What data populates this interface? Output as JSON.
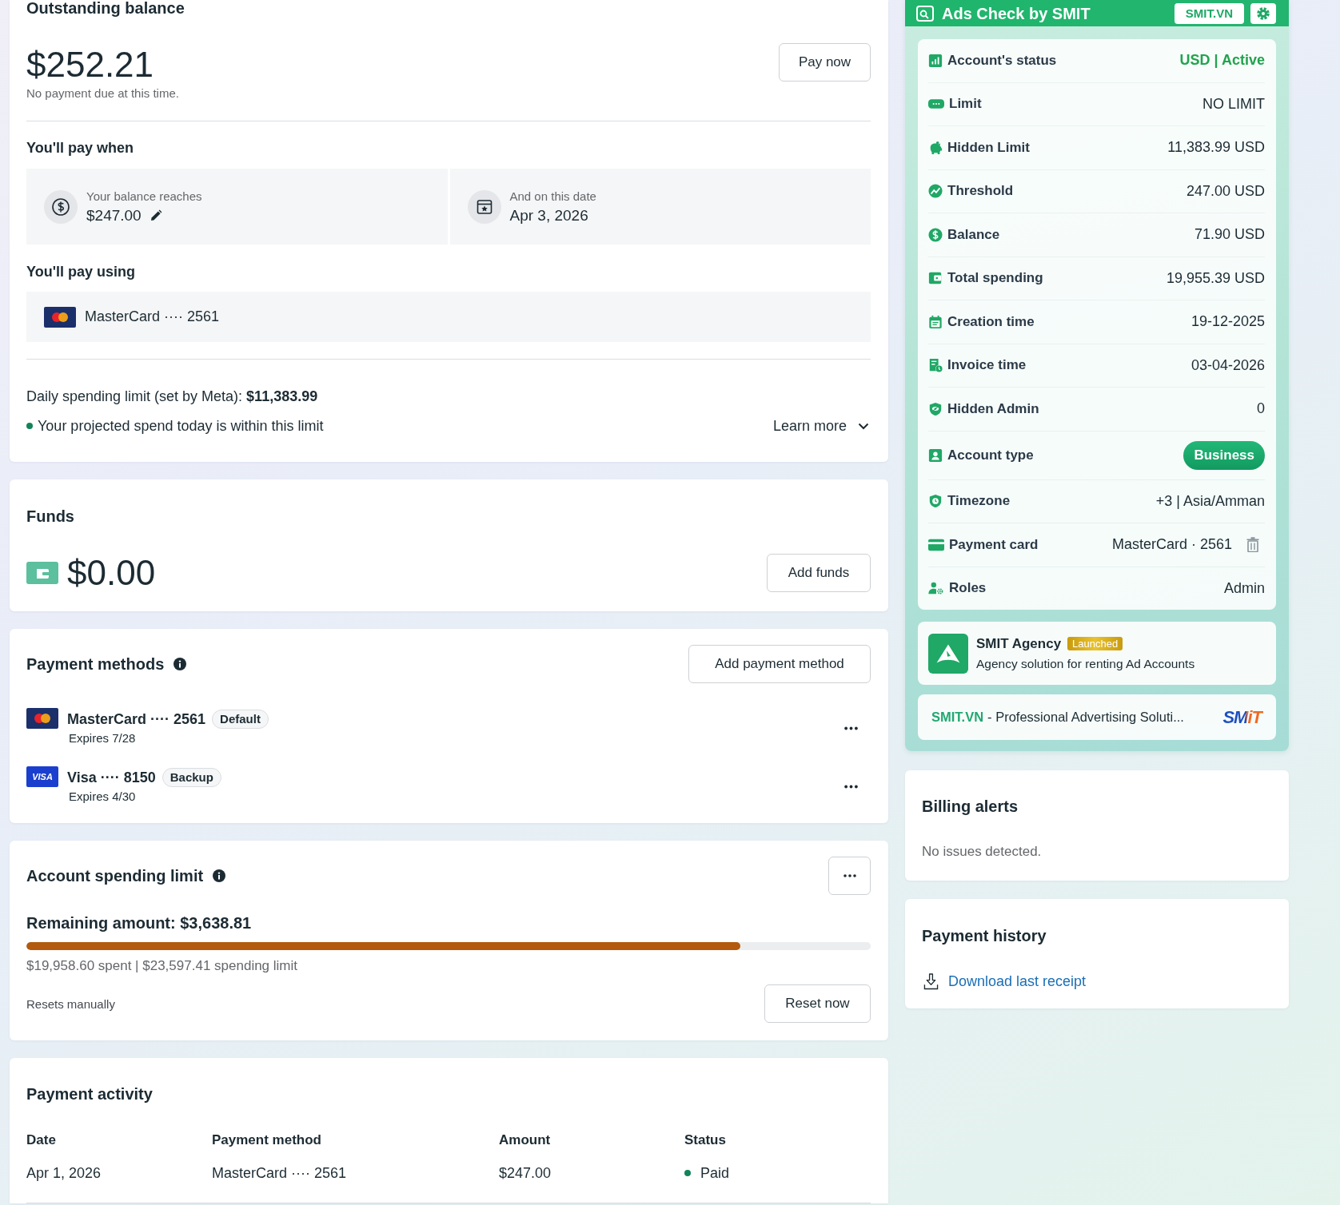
{
  "outstanding_balance": {
    "title": "Outstanding balance",
    "amount": "$252.21",
    "note": "No payment due at this time.",
    "pay_button": "Pay now"
  },
  "pay_when": {
    "title": "You'll pay when",
    "conditions": [
      {
        "kind": "balance",
        "label": "Your balance reaches",
        "value": "$247.00"
      },
      {
        "kind": "date",
        "label": "And on this date",
        "value": "Apr 3, 2026"
      }
    ]
  },
  "pay_using": {
    "title": "You'll pay using",
    "card": {
      "kind": "mastercard",
      "name": "MasterCard ···· 2561"
    }
  },
  "daily_limit": {
    "text": "Daily spending limit (set by Meta): **$11,383.99**",
    "projection": "Your projected spend today is within this limit",
    "learn_more": "Learn more"
  },
  "funds": {
    "title": "Funds",
    "amount": "$0.00",
    "button": "Add funds"
  },
  "payment_methods": {
    "title": "Payment methods",
    "add_button": "Add payment method",
    "methods": [
      {
        "kind": "mastercard",
        "name": "MasterCard ···· 2561",
        "badge": "Default",
        "expires": "Expires 7/28"
      },
      {
        "kind": "visa",
        "logo": "VISA",
        "name": "Visa ···· 8150",
        "badge": "Backup",
        "expires": "Expires 4/30"
      }
    ]
  },
  "spending_limit": {
    "title": "Account spending limit",
    "remaining": "Remaining amount: $3,638.81",
    "level": 0.846,
    "summary": "$19,958.60 spent | $23,597.41 spending limit",
    "resets": "Resets manually",
    "reset_button": "Reset now"
  },
  "payment_activity": {
    "title": "Payment activity",
    "columns": [
      "Date",
      "Payment method",
      "Amount",
      "Status"
    ],
    "rows": [
      {
        "date": "Apr 1, 2026",
        "method": "MasterCard ···· 2561",
        "amount": "$247.00",
        "status": "Paid"
      }
    ]
  },
  "ads_check": {
    "title": "Ads Check by SMIT",
    "link_button": "SMIT.VN",
    "rows": [
      {
        "kind": "status",
        "label": "Account's status",
        "value": "USD | Active"
      },
      {
        "kind": "text",
        "label": "Limit",
        "value": "NO LIMIT"
      },
      {
        "kind": "text",
        "label": "Hidden Limit",
        "value": "11,383.99 USD"
      },
      {
        "kind": "text",
        "label": "Threshold",
        "value": "247.00 USD"
      },
      {
        "kind": "text",
        "label": "Balance",
        "value": "71.90 USD"
      },
      {
        "kind": "text",
        "label": "Total spending",
        "value": "19,955.39 USD"
      },
      {
        "kind": "text",
        "label": "Creation time",
        "value": "19-12-2025"
      },
      {
        "kind": "text",
        "label": "Invoice time",
        "value": "03-04-2026"
      },
      {
        "kind": "text",
        "label": "Hidden Admin",
        "value": "0"
      },
      {
        "kind": "badge",
        "label": "Account type",
        "value": "Business"
      },
      {
        "kind": "text",
        "label": "Timezone",
        "value": "+3 | Asia/Amman"
      },
      {
        "kind": "card",
        "label": "Payment card",
        "value": "MasterCard · 2561"
      },
      {
        "kind": "text",
        "label": "Roles",
        "value": "Admin"
      }
    ],
    "agency": {
      "name": "SMIT Agency",
      "badge": "Launched",
      "description": "Agency solution for renting Ad Accounts"
    },
    "banner": {
      "site": "SMIT.VN",
      "tagline": "- Professional Advertising Soluti...",
      "logo": "SMiT"
    }
  },
  "billing_alerts": {
    "title": "Billing alerts",
    "message": "No issues detected."
  },
  "payment_history": {
    "title": "Payment history",
    "link": "Download last receipt"
  }
}
